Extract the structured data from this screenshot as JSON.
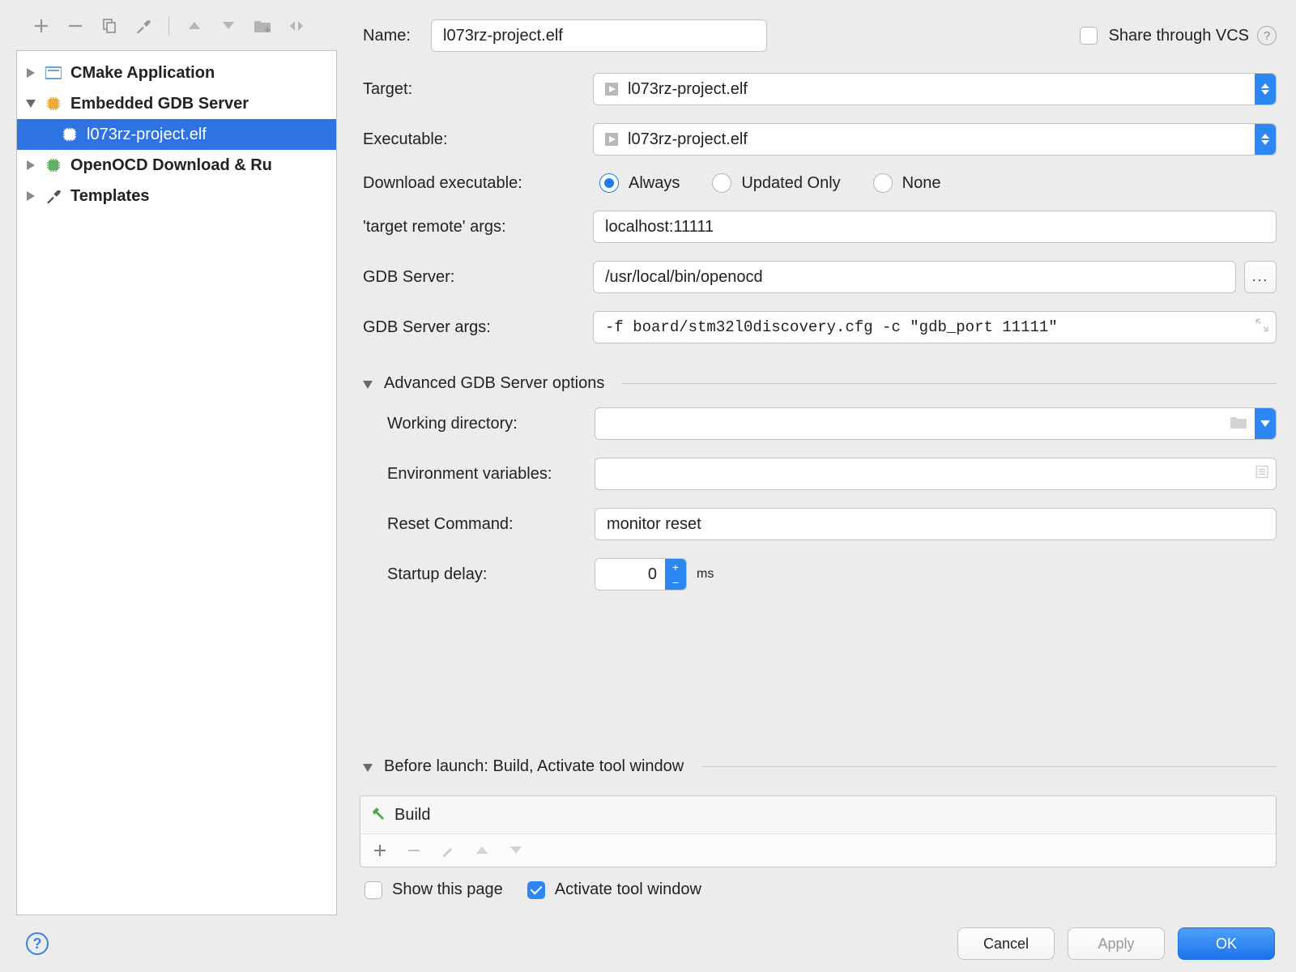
{
  "sidebar": {
    "tree": {
      "cmake": "CMake Application",
      "embedded": "Embedded GDB Server",
      "selected": "l073rz-project.elf",
      "openocd": "OpenOCD Download & Ru",
      "templates": "Templates"
    }
  },
  "top": {
    "name_label": "Name:",
    "name_value": "l073rz-project.elf",
    "share": "Share through VCS"
  },
  "form": {
    "target_label": "Target:",
    "target_value": "l073rz-project.elf",
    "executable_label": "Executable:",
    "executable_value": "l073rz-project.elf",
    "download_label": "Download executable:",
    "download": {
      "always": "Always",
      "updated": "Updated Only",
      "none": "None"
    },
    "remote_label": "'target remote' args:",
    "remote_value": "localhost:11111",
    "gdb_label": "GDB Server:",
    "gdb_value": "/usr/local/bin/openocd",
    "gdb_browse": "...",
    "args_label": "GDB Server args:",
    "args_value": "-f board/stm32l0discovery.cfg -c \"gdb_port 11111\""
  },
  "advanced": {
    "header": "Advanced GDB Server options",
    "wd_label": "Working directory:",
    "wd_value": "",
    "env_label": "Environment variables:",
    "env_value": "",
    "reset_label": "Reset Command:",
    "reset_value": "monitor reset",
    "delay_label": "Startup delay:",
    "delay_value": "0",
    "delay_unit": "ms"
  },
  "before": {
    "header": "Before launch: Build, Activate tool window",
    "item": "Build",
    "show": "Show this page",
    "activate": "Activate tool window"
  },
  "buttons": {
    "cancel": "Cancel",
    "apply": "Apply",
    "ok": "OK"
  }
}
